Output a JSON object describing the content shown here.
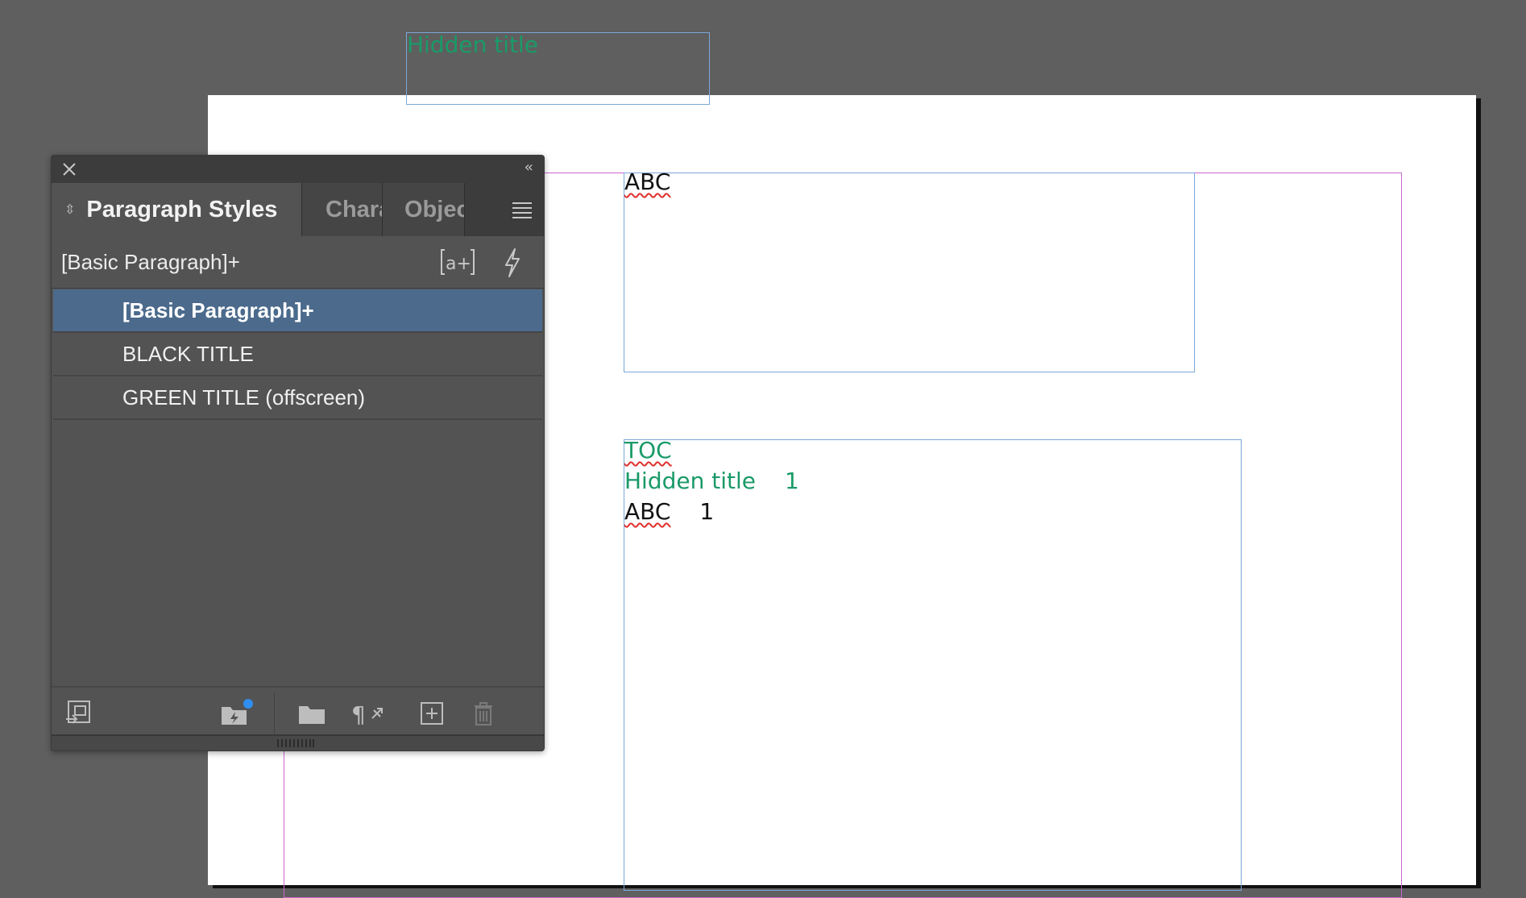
{
  "document": {
    "hidden_frame_text": "Hidden title",
    "abc_frame_text": "ABC",
    "toc": {
      "heading": "TOC",
      "entries": [
        {
          "title": "Hidden title",
          "page": "1"
        },
        {
          "title": "ABC",
          "page": "1"
        }
      ]
    }
  },
  "panel": {
    "tabs": {
      "active": "Paragraph Styles",
      "second": "Character Styles",
      "third": "Object Styles"
    },
    "current_style": "[Basic Paragraph]+",
    "styles": [
      {
        "label": "[Basic Paragraph]+",
        "selected": true
      },
      {
        "label": "BLACK TITLE",
        "selected": false
      },
      {
        "label": "GREEN TITLE (offscreen)",
        "selected": false
      }
    ],
    "icons": {
      "close": "close-icon",
      "collapse": "collapse-panel-icon",
      "menu": "panel-menu-icon",
      "create_new_style_from_selection": "new-style-from-selection-icon",
      "quick_apply": "lightning-icon",
      "load_styles": "load-styles-icon",
      "style_group_from_cc": "library-style-icon",
      "new_group": "folder-icon",
      "clear_overrides": "clear-overrides-icon",
      "new_style": "new-style-icon",
      "delete": "trash-icon"
    },
    "colors": {
      "selected_row": "#4b6a8c",
      "panel_bg": "#535353",
      "accent_dot": "#2f8ef0"
    }
  },
  "colors": {
    "green_text": "#1a9a68",
    "frame_border": "#7aa7d8",
    "margin_guide": "#cc66cc"
  }
}
